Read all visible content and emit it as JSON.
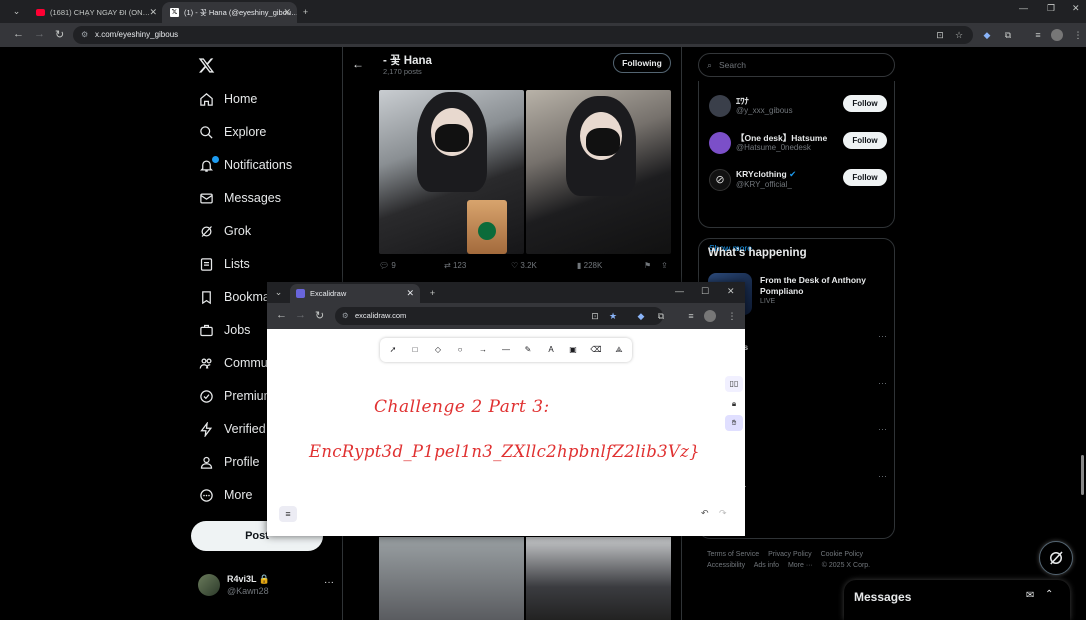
{
  "browser": {
    "tabs": [
      {
        "title": "(1681) CHẠY NGAY ĐI (ON…",
        "active": false
      },
      {
        "title": "(1) - 꽃 Hana (@eyeshiny_gibou…",
        "active": true
      }
    ],
    "url": "x.com/eyeshiny_gibous"
  },
  "x": {
    "nav": [
      {
        "label": "Home",
        "icon": "home-icon"
      },
      {
        "label": "Explore",
        "icon": "search-icon"
      },
      {
        "label": "Notifications",
        "icon": "bell-icon"
      },
      {
        "label": "Messages",
        "icon": "mail-icon"
      },
      {
        "label": "Grok",
        "icon": "grok-icon"
      },
      {
        "label": "Lists",
        "icon": "list-icon"
      },
      {
        "label": "Bookmarks",
        "icon": "bookmark-icon"
      },
      {
        "label": "Jobs",
        "icon": "briefcase-icon"
      },
      {
        "label": "Communities",
        "icon": "people-icon"
      },
      {
        "label": "Premium",
        "icon": "premium-icon"
      },
      {
        "label": "Verified Orgs",
        "icon": "lightning-icon"
      },
      {
        "label": "Profile",
        "icon": "person-icon"
      },
      {
        "label": "More",
        "icon": "more-icon"
      }
    ],
    "post_label": "Post",
    "me": {
      "name": "R4vi3L 🔒",
      "handle": "@Kawn28"
    },
    "profile_header": {
      "name": "- 꽃 Hana",
      "posts": "2,170 posts",
      "following_label": "Following"
    },
    "tweet_actions": {
      "replies": "9",
      "reposts": "123",
      "likes": "3.2K",
      "views": "228K"
    },
    "search_placeholder": "Search",
    "who_to_follow": [
      {
        "name": "ｴﾜﾅ",
        "handle": "@y_xxx_gibous",
        "button": "Follow",
        "color": "#3a3f4a"
      },
      {
        "name": "【One desk】Hatsume",
        "handle": "@Hatsume_0nedesk",
        "button": "Follow",
        "color": "#7b4fc8"
      },
      {
        "name": "KRYclothing",
        "handle": "@KRY_official_",
        "button": "Follow",
        "color": "#111111"
      }
    ],
    "show_more": "Show more",
    "whats_happening": {
      "title": "What’s happening",
      "item": {
        "title": "From the Desk of Anthony Pompliano",
        "status": "LIVE"
      },
      "partial_texts": [
        "ls",
        "4"
      ]
    },
    "footer": [
      "Terms of Service",
      "Privacy Policy",
      "Cookie Policy",
      "Accessibility",
      "Ads info",
      "More ···",
      "© 2025 X Corp."
    ],
    "messages_drawer": "Messages"
  },
  "excalidraw": {
    "tab_title": "Excalidraw",
    "url": "excalidraw.com",
    "text_line1": "Challenge 2 Part 3:",
    "text_line2": "EncRypt3d_P1pel1n3_ZXllc2hpbnlfZ2lib3Vz}"
  }
}
